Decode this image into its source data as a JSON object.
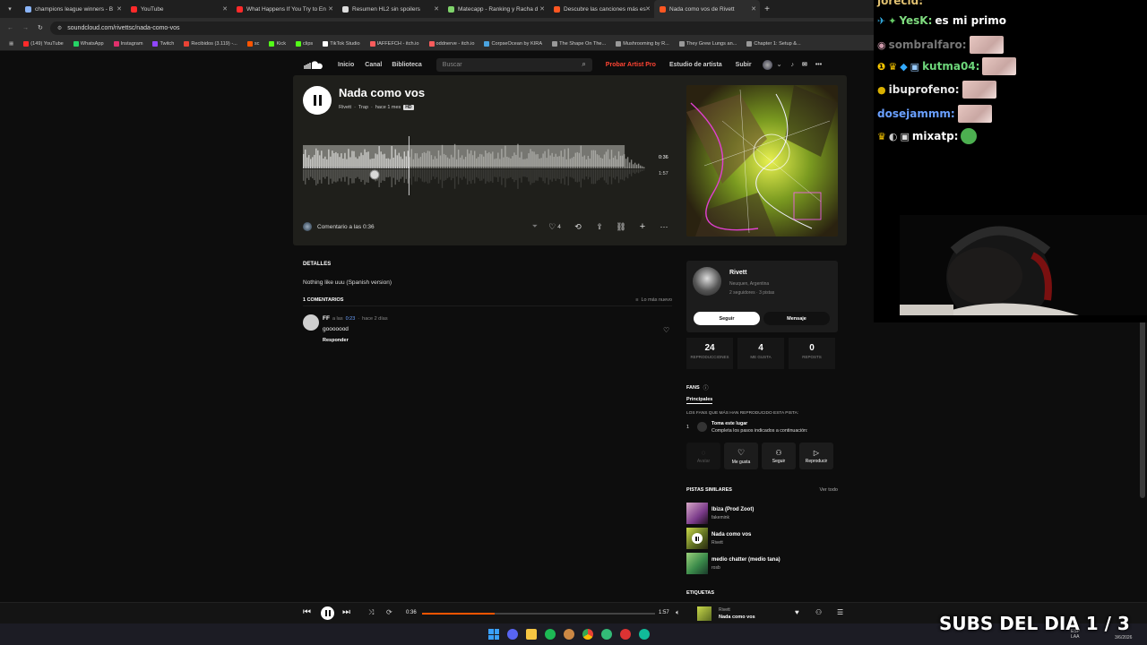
{
  "browser": {
    "tabs": [
      {
        "title": "champions league winners - B",
        "color": "#8ab4f8"
      },
      {
        "title": "YouTube",
        "color": "#ff2a2a"
      },
      {
        "title": "What Happens If You Try to En",
        "color": "#ff2a2a"
      },
      {
        "title": "Resumen HL2 sin spoilers",
        "color": "#dddddd"
      },
      {
        "title": "Matecapp - Ranking y Racha d",
        "color": "#7fd36b"
      },
      {
        "title": "Descubre las canciones más es",
        "color": "#ff5722"
      },
      {
        "title": "Nada como vos de Rivett",
        "color": "#ff5722"
      }
    ],
    "url": "soundcloud.com/rivettsc/nada-como-vos",
    "bookmarks": [
      {
        "label": "(149) YouTube",
        "color": "#ff2a2a"
      },
      {
        "label": "WhatsApp",
        "color": "#25d366"
      },
      {
        "label": "Instagram",
        "color": "#e1306c"
      },
      {
        "label": "Twitch",
        "color": "#9146ff"
      },
      {
        "label": "Recibidos (3.119) -...",
        "color": "#ea4335"
      },
      {
        "label": "sc",
        "color": "#ff5500"
      },
      {
        "label": "Kick",
        "color": "#53fc18"
      },
      {
        "label": "clips",
        "color": "#53fc18"
      },
      {
        "label": "TikTok Studio",
        "color": "#ffffff"
      },
      {
        "label": "IAFFEFCH - itch.io",
        "color": "#fa5c5c"
      },
      {
        "label": "oddnerve - itch.io",
        "color": "#fa5c5c"
      },
      {
        "label": "CorpseOcean by KIRA",
        "color": "#4aa3df"
      },
      {
        "label": "The Shape On The...",
        "color": "#999999"
      },
      {
        "label": "Mushrooming by R...",
        "color": "#999999"
      },
      {
        "label": "They Grew Lungs an...",
        "color": "#999999"
      },
      {
        "label": "Chapter 1: Setup &...",
        "color": "#999999"
      }
    ],
    "all_bookmarks": "Todos los favoritos"
  },
  "nav": {
    "items": [
      "Inicio",
      "Canal",
      "Biblioteca"
    ],
    "search_placeholder": "Buscar",
    "artist_pro": "Probar Artist Pro",
    "studio": "Estudio de artista",
    "upload": "Subir"
  },
  "track": {
    "title": "Nada como vos",
    "artist": "Rivett",
    "genre": "Trap",
    "age": "hace 1 mes",
    "quality_badge": "HD",
    "current_time": "0:36",
    "duration": "1:57",
    "progress": 0.31,
    "comment_placeholder": "Comentario a las 0:36",
    "likes": "4"
  },
  "details": {
    "heading": "DETALLES",
    "description": "Nothing like uuu (Spanish version)",
    "comments_heading": "1 COMENTARIOS",
    "sort_label": "Lo más nuevo",
    "comments": [
      {
        "user": "FF",
        "prefix": "a las",
        "at": "0:23",
        "age": "hace 2 días",
        "text": "gooooood",
        "reply": "Responder"
      }
    ]
  },
  "artist_card": {
    "name": "Rivett",
    "location": "Neuquen, Argentina",
    "followers": "2 seguidores · 3 pistas",
    "follow": "Seguir",
    "message": "Mensaje"
  },
  "stats": [
    {
      "value": "24",
      "label": "REPRODUCCIONES"
    },
    {
      "value": "4",
      "label": "ME GUSTA"
    },
    {
      "value": "0",
      "label": "REPOSTS"
    }
  ],
  "fans": {
    "heading": "FANS",
    "tab": "Principales",
    "subtitle": "LOS FANS QUE MÁS HAN REPRODUCIDO ESTA PISTA:",
    "rank": "1",
    "claim_title": "Toma este lugar",
    "claim_text": "Completa los pasos indicados a continuación:",
    "actions": [
      "Avatar",
      "Me gusta",
      "Seguir",
      "Reproducir"
    ]
  },
  "similar": {
    "heading": "PISTAS SIMILARES",
    "see_all": "Ver todo",
    "items": [
      {
        "title": "Ibiza (Prod Zoot)",
        "artist": "fakemink",
        "color": "#7a3a8a"
      },
      {
        "title": "Nada como vos",
        "artist": "Rivett",
        "color": "#5a6a20"
      },
      {
        "title": "medio chatter (medio tana)",
        "artist": "rosb",
        "color": "#3a8a4a"
      }
    ],
    "tags_heading": "ETIQUETAS"
  },
  "player": {
    "current_time": "0:36",
    "duration": "1:57",
    "progress": 0.31,
    "artist": "Rivett",
    "title": "Nada como vos"
  },
  "stream_chat": [
    {
      "user": "jorecid:",
      "text": ""
    },
    {
      "user": "YesK:",
      "text": "es mi primo"
    },
    {
      "user": "sombralfaro:",
      "text": ""
    },
    {
      "user": "kutma04:",
      "text": ""
    },
    {
      "user": "ibuprofeno:",
      "text": ""
    },
    {
      "user": "dosejammm:",
      "text": ""
    },
    {
      "user": "mixatp:",
      "text": ""
    }
  ],
  "stream_overlay": "SUBS DEL DIA 1 / 3",
  "taskbar": {
    "lang": "ESP LAA",
    "time": "",
    "date": "3/6/2026"
  }
}
